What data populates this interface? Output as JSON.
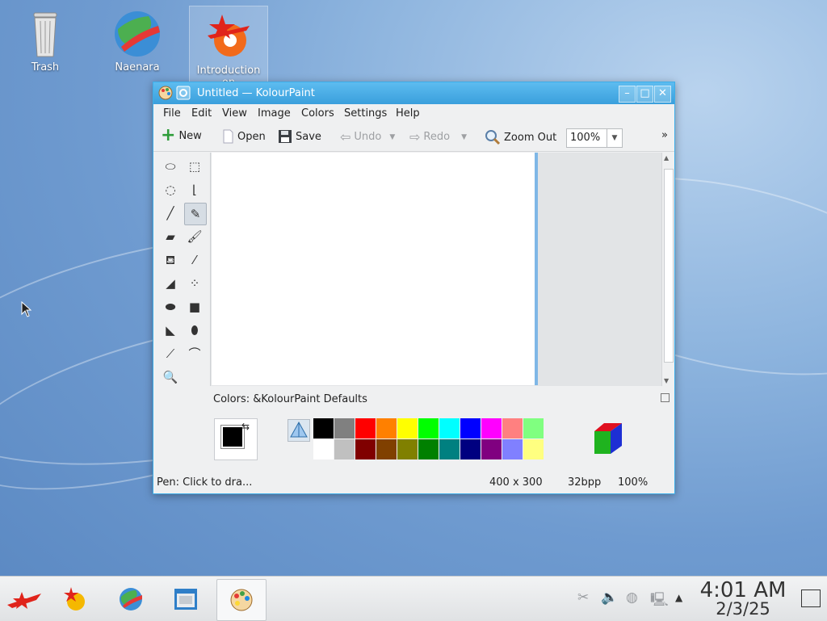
{
  "desktop": {
    "icons": [
      {
        "label": "Trash",
        "icon": "trash-icon"
      },
      {
        "label": "Naenara",
        "icon": "globe-icon"
      },
      {
        "label": "Introduction on",
        "icon": "red-star-gear-icon"
      }
    ]
  },
  "window": {
    "title": "Untitled — KolourPaint",
    "menu": [
      "File",
      "Edit",
      "View",
      "Image",
      "Colors",
      "Settings",
      "Help"
    ],
    "toolbar": {
      "new": "New",
      "open": "Open",
      "save": "Save",
      "undo": "Undo",
      "redo": "Redo",
      "zoom_out": "Zoom Out",
      "zoom_value": "100%",
      "overflow": "»"
    },
    "colors_label": "Colors: &KolourPaint Defaults",
    "palette_top": [
      "#000000",
      "#808080",
      "#ff0000",
      "#ff8000",
      "#ffff00",
      "#00ff00",
      "#00ffff",
      "#0000ff",
      "#ff00ff",
      "#ff8080",
      "#80ff80"
    ],
    "palette_bottom": [
      "#ffffff",
      "#c0c0c0",
      "#800000",
      "#804000",
      "#808000",
      "#008000",
      "#008080",
      "#000080",
      "#800080",
      "#8080ff",
      "#ffff80"
    ],
    "status": {
      "message": "Pen: Click to dra...",
      "size": "400 x 300",
      "depth": "32bpp",
      "zoom": "100%"
    }
  },
  "taskbar": {
    "clock_time": "4:01 AM",
    "clock_date": "2/3/25"
  }
}
